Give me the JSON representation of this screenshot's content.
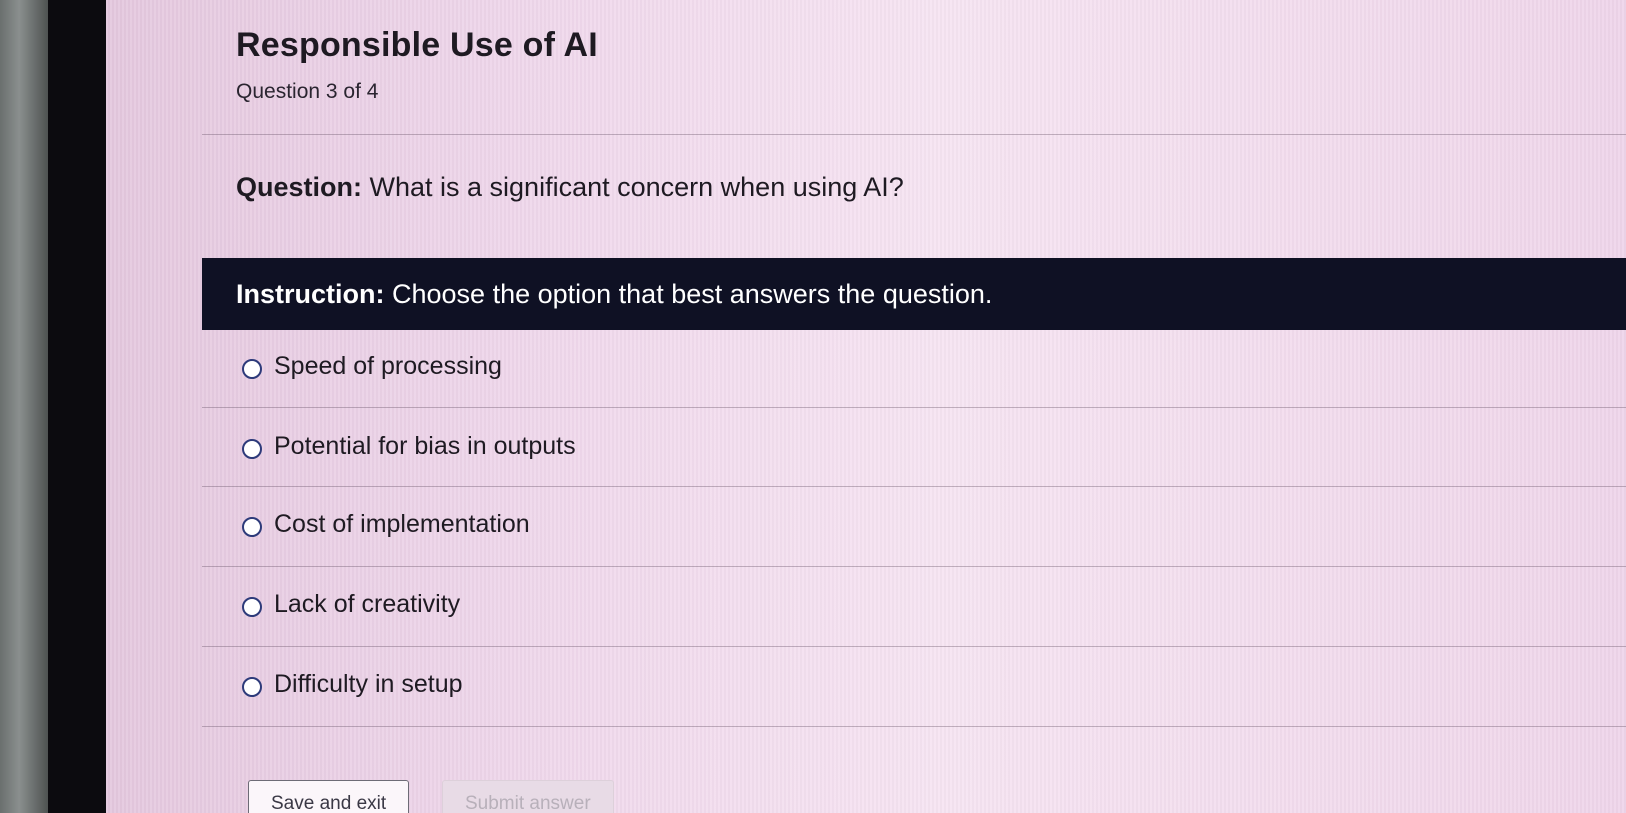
{
  "quiz": {
    "title": "Responsible Use of AI",
    "progress": "Question 3 of 4"
  },
  "question": {
    "label": "Question:",
    "text": " What is a significant concern when using AI?"
  },
  "instruction": {
    "label": "Instruction:",
    "text": " Choose the option that best answers the question."
  },
  "options": [
    {
      "label": "Speed of processing",
      "selected": false
    },
    {
      "label": "Potential for bias in outputs",
      "selected": false
    },
    {
      "label": "Cost of implementation",
      "selected": false
    },
    {
      "label": "Lack of creativity",
      "selected": false
    },
    {
      "label": "Difficulty in setup",
      "selected": false
    }
  ],
  "actions": {
    "save_label": "Save and exit",
    "submit_label": "Submit answer"
  },
  "colors": {
    "instruction_bar": "#0f1124",
    "radio_border": "#2d3a7a",
    "page_background": "#e9cde3"
  }
}
